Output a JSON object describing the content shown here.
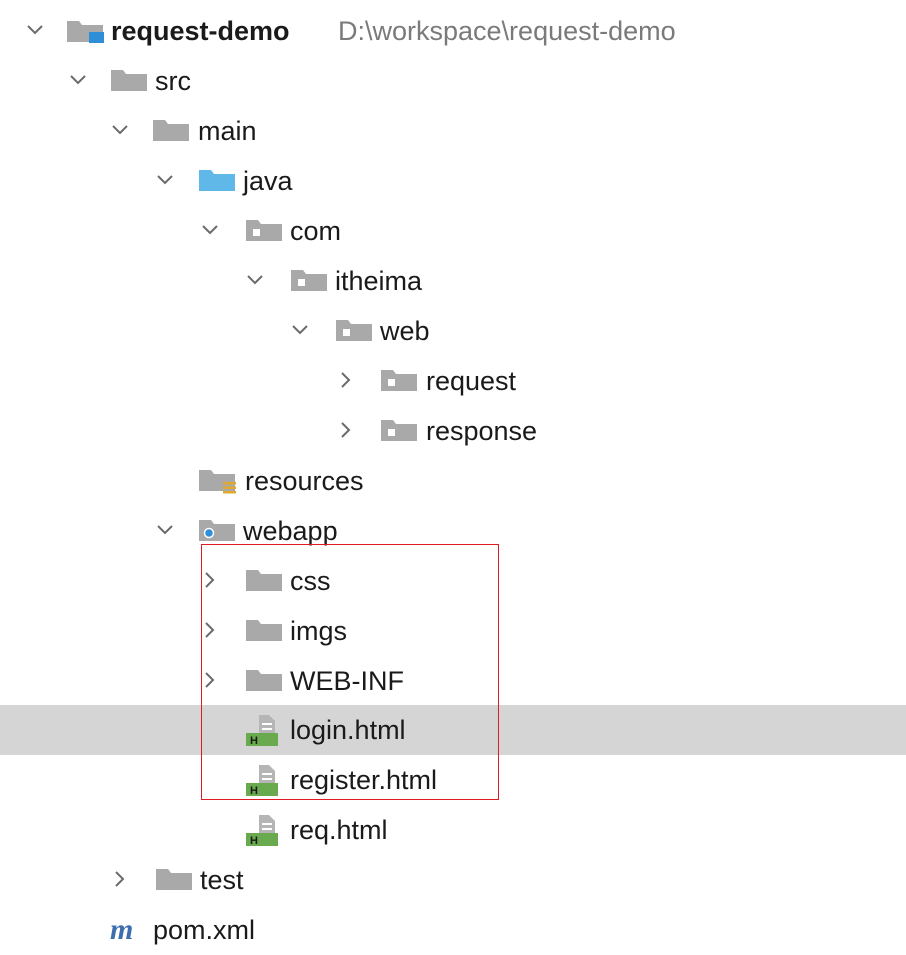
{
  "project": {
    "name": "request-demo",
    "path": "D:\\workspace\\request-demo"
  },
  "nodes": {
    "src": "src",
    "main": "main",
    "java": "java",
    "com": "com",
    "itheima": "itheima",
    "web": "web",
    "request": "request",
    "response": "response",
    "resources": "resources",
    "webapp": "webapp",
    "css": "css",
    "imgs": "imgs",
    "web_inf": "WEB-INF",
    "login_html": "login.html",
    "register_html": "register.html",
    "req_html": "req.html",
    "test": "test",
    "pom_xml": "pom.xml"
  },
  "icons": {
    "project": "module-folder-icon",
    "folder": "folder-icon",
    "source_root": "source-root-folder-icon",
    "package": "package-folder-icon",
    "resources": "resources-folder-icon",
    "web": "web-folder-icon",
    "html_file": "html-file-icon",
    "maven": "maven-icon"
  },
  "colors": {
    "selection": "#d5d5d5",
    "highlight_border": "#e01b24",
    "folder_gray": "#a9a9a9",
    "source_blue": "#5fb8e8",
    "module_blue": "#2e8fd6",
    "html_green": "#6aaa4f",
    "maven_blue": "#3d6fb0"
  }
}
